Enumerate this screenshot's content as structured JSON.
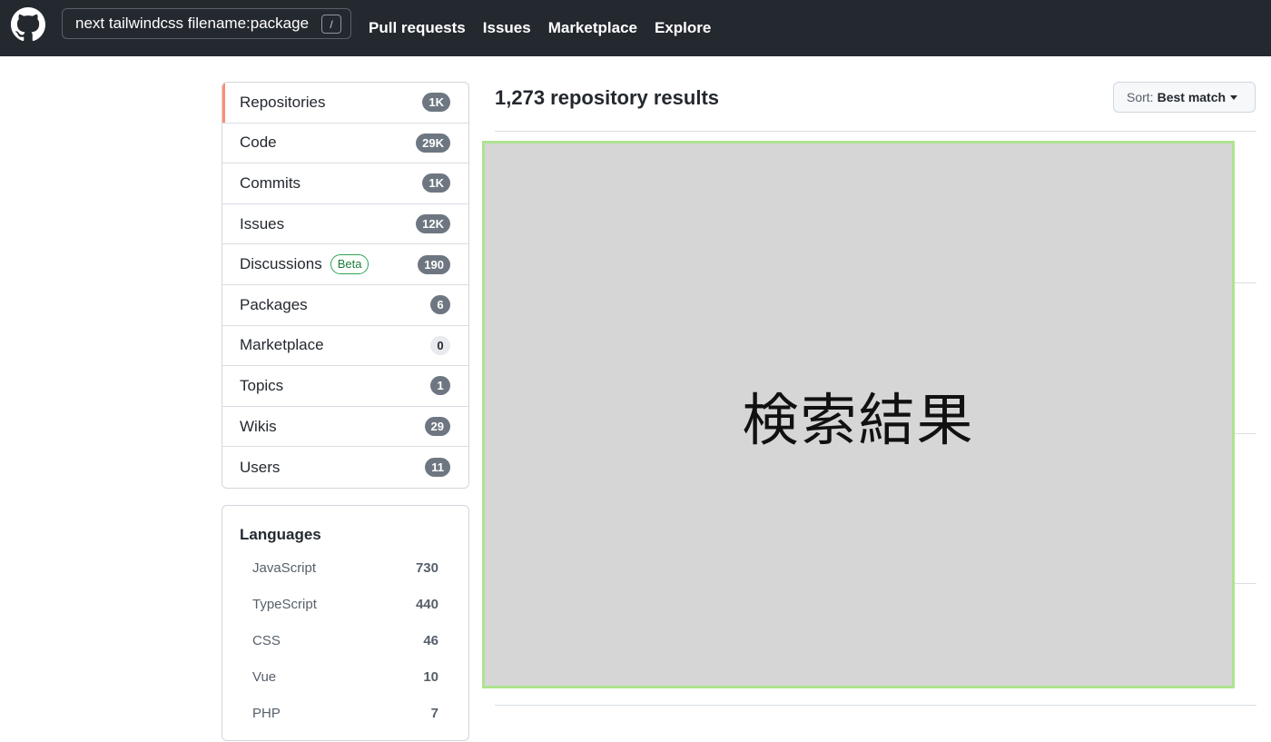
{
  "header": {
    "search_value": "next tailwindcss filename:package",
    "slash_hint": "/",
    "nav": [
      "Pull requests",
      "Issues",
      "Marketplace",
      "Explore"
    ]
  },
  "sidebar": {
    "items": [
      {
        "label": "Repositories",
        "count": "1K",
        "selected": true
      },
      {
        "label": "Code",
        "count": "29K"
      },
      {
        "label": "Commits",
        "count": "1K"
      },
      {
        "label": "Issues",
        "count": "12K"
      },
      {
        "label": "Discussions",
        "badge": "Beta",
        "count": "190"
      },
      {
        "label": "Packages",
        "count": "6"
      },
      {
        "label": "Marketplace",
        "count": "0"
      },
      {
        "label": "Topics",
        "count": "1"
      },
      {
        "label": "Wikis",
        "count": "29"
      },
      {
        "label": "Users",
        "count": "11"
      }
    ],
    "languages_title": "Languages",
    "languages": [
      {
        "name": "JavaScript",
        "count": "730"
      },
      {
        "name": "TypeScript",
        "count": "440"
      },
      {
        "name": "CSS",
        "count": "46"
      },
      {
        "name": "Vue",
        "count": "10"
      },
      {
        "name": "PHP",
        "count": "7"
      }
    ]
  },
  "main": {
    "results_title": "1,273 repository results",
    "sort_label": "Sort:",
    "sort_value": "Best match",
    "placeholder_text": "検索結果"
  },
  "colors": {
    "header_bg": "#24292f",
    "selected_accent": "#fd8c73",
    "beta_green": "#1a7f37",
    "placeholder_bg": "#d6d6d6",
    "placeholder_border": "#aee38f"
  }
}
